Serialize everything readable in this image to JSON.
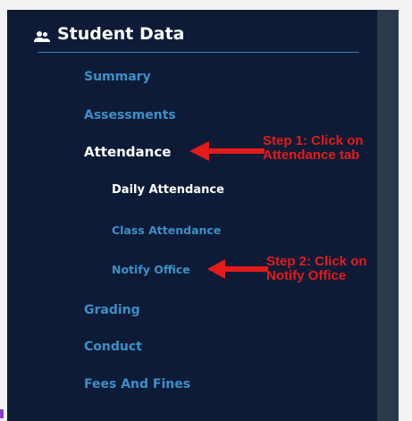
{
  "header": {
    "icon": "users-icon",
    "title": "Student Data"
  },
  "menu": {
    "summary": "Summary",
    "assessments": "Assessments",
    "attendance": "Attendance",
    "daily_attendance": "Daily Attendance",
    "class_attendance": "Class Attendance",
    "notify_office": "Notify Office",
    "grading": "Grading",
    "conduct": "Conduct",
    "fees": "Fees And Fines"
  },
  "annotations": {
    "step1_line1": "Step 1: Click on",
    "step1_line2": "Attendance tab",
    "step2_line1": "Step 2: Click on",
    "step2_line2": "Notify Office"
  },
  "colors": {
    "panel_bg": "#0d1b36",
    "link": "#3c8fc8",
    "active": "#ffffff",
    "annotation": "#e31b1b"
  }
}
